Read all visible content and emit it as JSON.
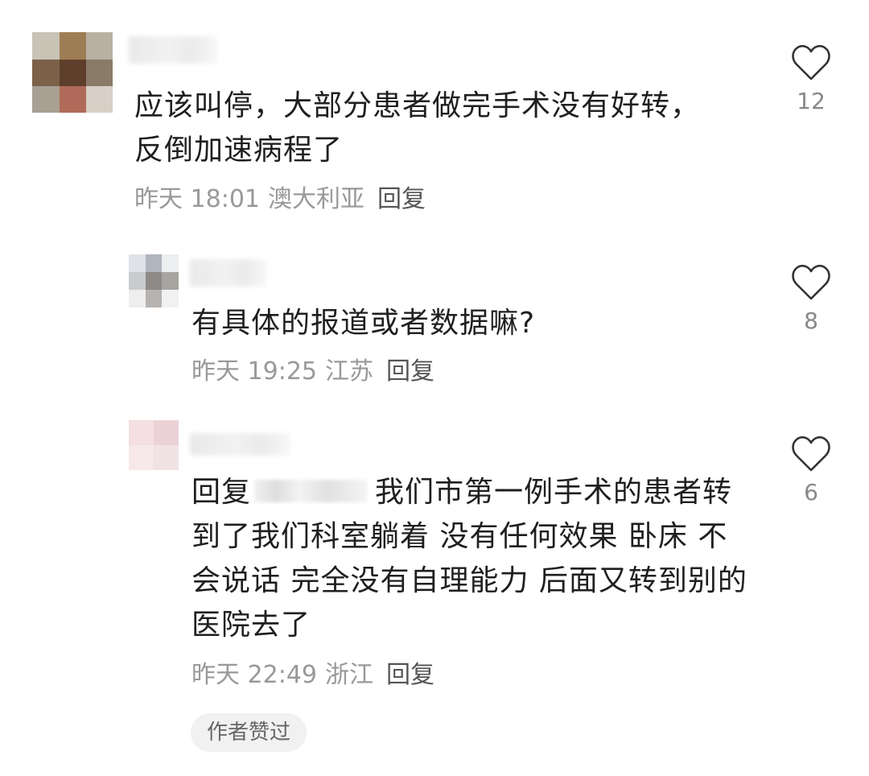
{
  "comments": [
    {
      "text": "应该叫停，大部分患者做完手术没有好转，反倒加速病程了",
      "time": "昨天 18:01",
      "location": "澳大利亚",
      "reply_label": "回复",
      "likes": "12"
    },
    {
      "text": "有具体的报道或者数据嘛?",
      "time": "昨天 19:25",
      "location": "江苏",
      "reply_label": "回复",
      "likes": "8"
    },
    {
      "reply_prefix": "回复",
      "text": "我们市第一例手术的患者转到了我们科室躺着 没有任何效果 卧床 不会说话 完全没有自理能力 后面又转到别的医院去了",
      "time": "昨天 22:49",
      "location": "浙江",
      "reply_label": "回复",
      "likes": "6",
      "badge": "作者赞过"
    }
  ],
  "icons": {
    "like": "heart-outline-icon"
  },
  "colors": {
    "text": "#1f1f1f",
    "meta": "#999999",
    "badge_bg": "#f1f1f1"
  }
}
